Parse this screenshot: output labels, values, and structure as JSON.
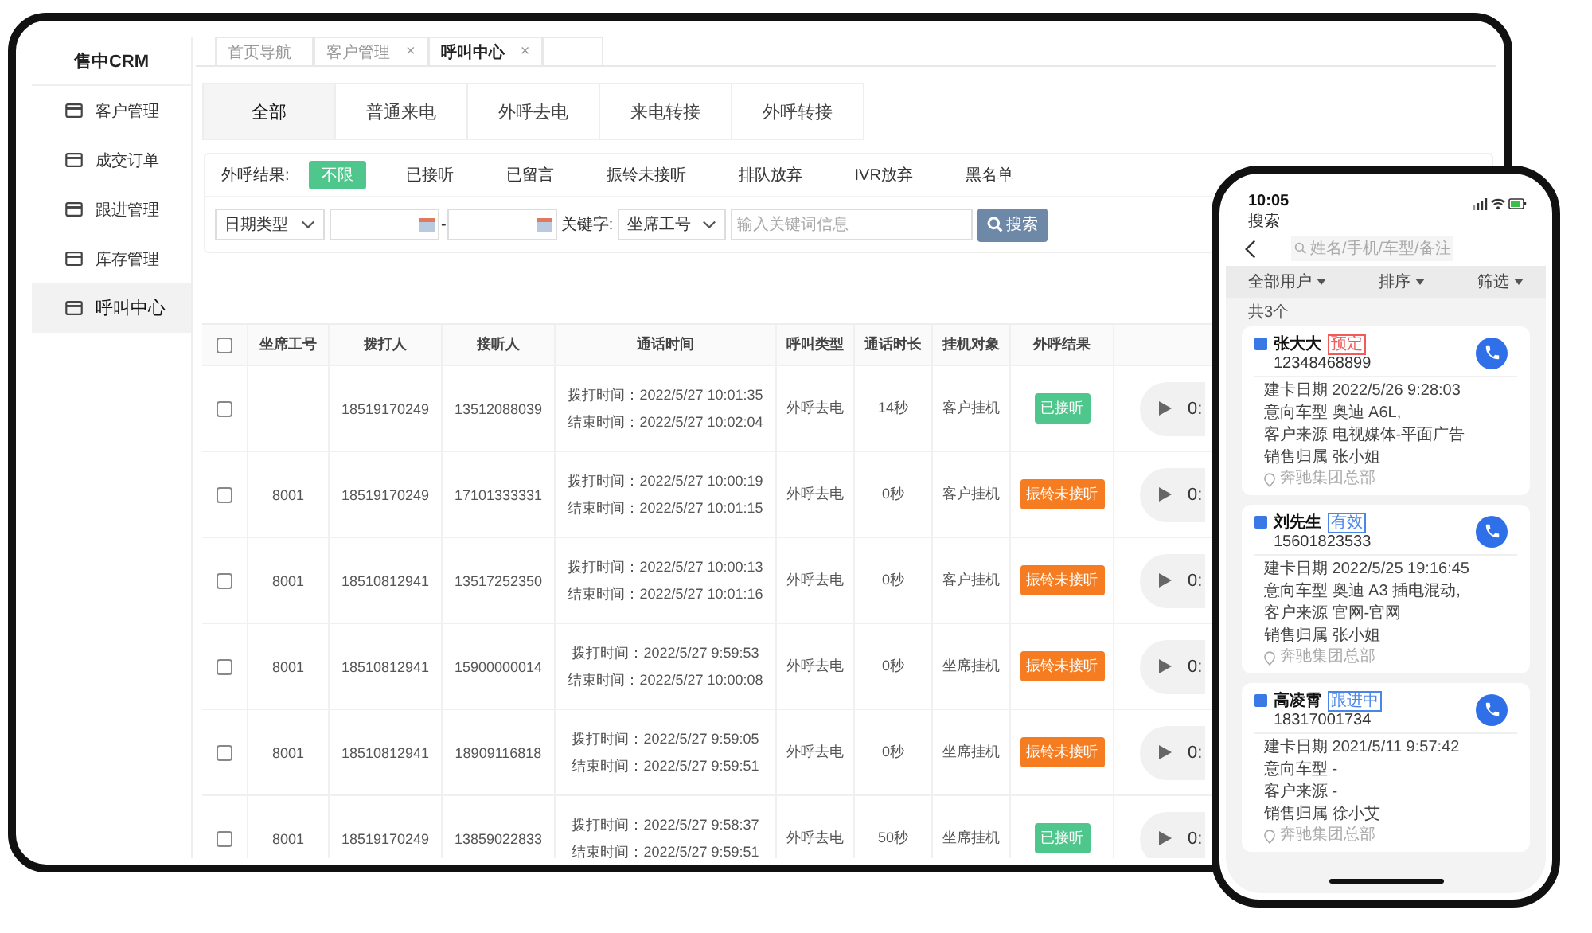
{
  "sidebar": {
    "title": "售中CRM",
    "items": [
      {
        "label": "客户管理",
        "selected": false
      },
      {
        "label": "成交订单",
        "selected": false
      },
      {
        "label": "跟进管理",
        "selected": false
      },
      {
        "label": "库存管理",
        "selected": false
      },
      {
        "label": "呼叫中心",
        "selected": true
      }
    ]
  },
  "tabs": [
    {
      "label": "首页导航",
      "selected": false
    },
    {
      "label": "客户管理",
      "close": "×",
      "selected": false
    },
    {
      "label": "呼叫中心",
      "close": "×",
      "selected": true
    }
  ],
  "call_type_tabs": [
    {
      "label": "全部",
      "selected": true
    },
    {
      "label": "普通来电",
      "selected": false
    },
    {
      "label": "外呼去电",
      "selected": false
    },
    {
      "label": "来电转接",
      "selected": false
    },
    {
      "label": "外呼转接",
      "selected": false
    }
  ],
  "result_filter": {
    "label": "外呼结果:",
    "options": [
      {
        "label": "不限",
        "selected": true
      },
      {
        "label": "已接听",
        "selected": false
      },
      {
        "label": "已留言",
        "selected": false
      },
      {
        "label": "振铃未接听",
        "selected": false
      },
      {
        "label": "排队放弃",
        "selected": false
      },
      {
        "label": "IVR放弃",
        "selected": false
      },
      {
        "label": "黑名单",
        "selected": false
      }
    ]
  },
  "search": {
    "date_type": "日期类型",
    "separator": "-",
    "keyword_label": "关键字:",
    "keyword_field": "坐席工号",
    "placeholder": "输入关键词信息",
    "button": "搜索"
  },
  "table": {
    "columns": [
      "坐席工号",
      "拨打人",
      "接听人",
      "通话时间",
      "呼叫类型",
      "通话时长",
      "挂机对象",
      "外呼结果"
    ],
    "all_checked": false,
    "rows": [
      {
        "checked": false,
        "caller": "18519170249",
        "callee": "13512088039",
        "dial": "拨打时间：2022/5/27 10:01:35",
        "end": "结束时间：2022/5/27 10:02:04",
        "type": "外呼去电",
        "duration": "14秒",
        "hangup": "客户挂机",
        "result": "已接听",
        "color": "#4fc68b",
        "player": "0:"
      },
      {
        "checked": false,
        "agent": "8001",
        "caller": "18519170249",
        "callee": "17101333331",
        "dial": "拨打时间：2022/5/27 10:00:19",
        "end": "结束时间：2022/5/27 10:01:15",
        "type": "外呼去电",
        "duration": "0秒",
        "hangup": "客户挂机",
        "result": "振铃未接听",
        "color": "#f57c20",
        "player": "0:"
      },
      {
        "checked": false,
        "agent": "8001",
        "caller": "18510812941",
        "callee": "13517252350",
        "dial": "拨打时间：2022/5/27 10:00:13",
        "end": "结束时间：2022/5/27 10:01:16",
        "type": "外呼去电",
        "duration": "0秒",
        "hangup": "客户挂机",
        "result": "振铃未接听",
        "color": "#f57c20",
        "player": "0:"
      },
      {
        "checked": false,
        "agent": "8001",
        "caller": "18510812941",
        "callee": "15900000014",
        "dial": "拨打时间：2022/5/27 9:59:53",
        "end": "结束时间：2022/5/27 10:00:08",
        "type": "外呼去电",
        "duration": "0秒",
        "hangup": "坐席挂机",
        "result": "振铃未接听",
        "color": "#f57c20",
        "player": "0:"
      },
      {
        "checked": false,
        "agent": "8001",
        "caller": "18510812941",
        "callee": "18909116818",
        "dial": "拨打时间：2022/5/27 9:59:05",
        "end": "结束时间：2022/5/27 9:59:51",
        "type": "外呼去电",
        "duration": "0秒",
        "hangup": "坐席挂机",
        "result": "振铃未接听",
        "color": "#f57c20",
        "player": "0:"
      },
      {
        "checked": false,
        "agent": "8001",
        "caller": "18519170249",
        "callee": "13859022833",
        "dial": "拨打时间：2022/5/27 9:58:37",
        "end": "结束时间：2022/5/27 9:59:51",
        "type": "外呼去电",
        "duration": "50秒",
        "hangup": "坐席挂机",
        "result": "已接听",
        "color": "#4fc68b",
        "player": "0:"
      }
    ]
  },
  "phone": {
    "time": "10:05",
    "back_app": "搜索",
    "search_placeholder": "姓名/手机/车型/备注",
    "filters": [
      "全部用户",
      "排序",
      "筛选"
    ],
    "count": "共3个",
    "contacts": [
      {
        "name": "张大大",
        "tag": "预定",
        "color": "#f05a5a",
        "phone": "12348468899",
        "details": [
          "建卡日期 2022/5/26 9:28:03",
          "意向车型 奥迪 A6L,",
          "客户来源 电视媒体-平面广告",
          "销售归属 张小姐"
        ],
        "location": "奔驰集团总部"
      },
      {
        "name": "刘先生",
        "tag": "有效",
        "color": "#4a86e8",
        "phone": "15601823533",
        "details": [
          "建卡日期 2022/5/25 19:16:45",
          "意向车型 奥迪 A3 插电混动,",
          "客户来源 官网-官网",
          "销售归属 张小姐"
        ],
        "location": "奔驰集团总部"
      },
      {
        "name": "高凌霄",
        "tag": "跟进中",
        "color": "#4a86e8",
        "phone": "18317001734",
        "details": [
          "建卡日期 2021/5/11 9:57:42",
          "意向车型 -",
          "客户来源 -",
          "销售归属 徐小艾"
        ],
        "location": "奔驰集团总部"
      }
    ]
  }
}
